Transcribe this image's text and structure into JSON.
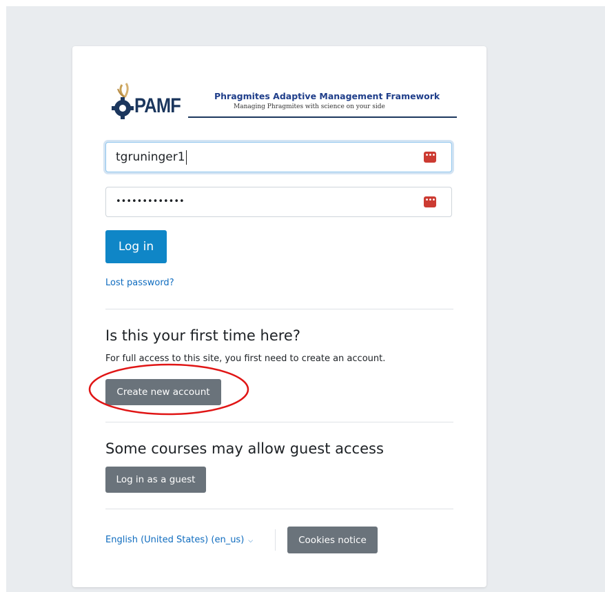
{
  "logo": {
    "abbr": "PAMF",
    "title": "Phragmites Adaptive Management Framework",
    "tagline": "Managing Phragmites with science on your side"
  },
  "login": {
    "username_value": "tgruninger1",
    "password_masked": "•••••••••••••",
    "login_label": "Log in",
    "lost_password": "Lost password?"
  },
  "signup": {
    "heading": "Is this your first time here?",
    "text": "For full access to this site, you first need to create an account.",
    "create_label": "Create new account"
  },
  "guest": {
    "heading": "Some courses may allow guest access",
    "button_label": "Log in as a guest"
  },
  "footer": {
    "language": "English (United States) (en_us)",
    "cookies_label": "Cookies notice"
  },
  "colors": {
    "primary": "#0f86c7",
    "secondary": "#6a737b",
    "link": "#0f6cbf",
    "annotation": "#e01515",
    "brand_navy": "#1b365d"
  },
  "icons": [
    "gear-icon",
    "password-manager-icon",
    "chevron-down-icon"
  ]
}
